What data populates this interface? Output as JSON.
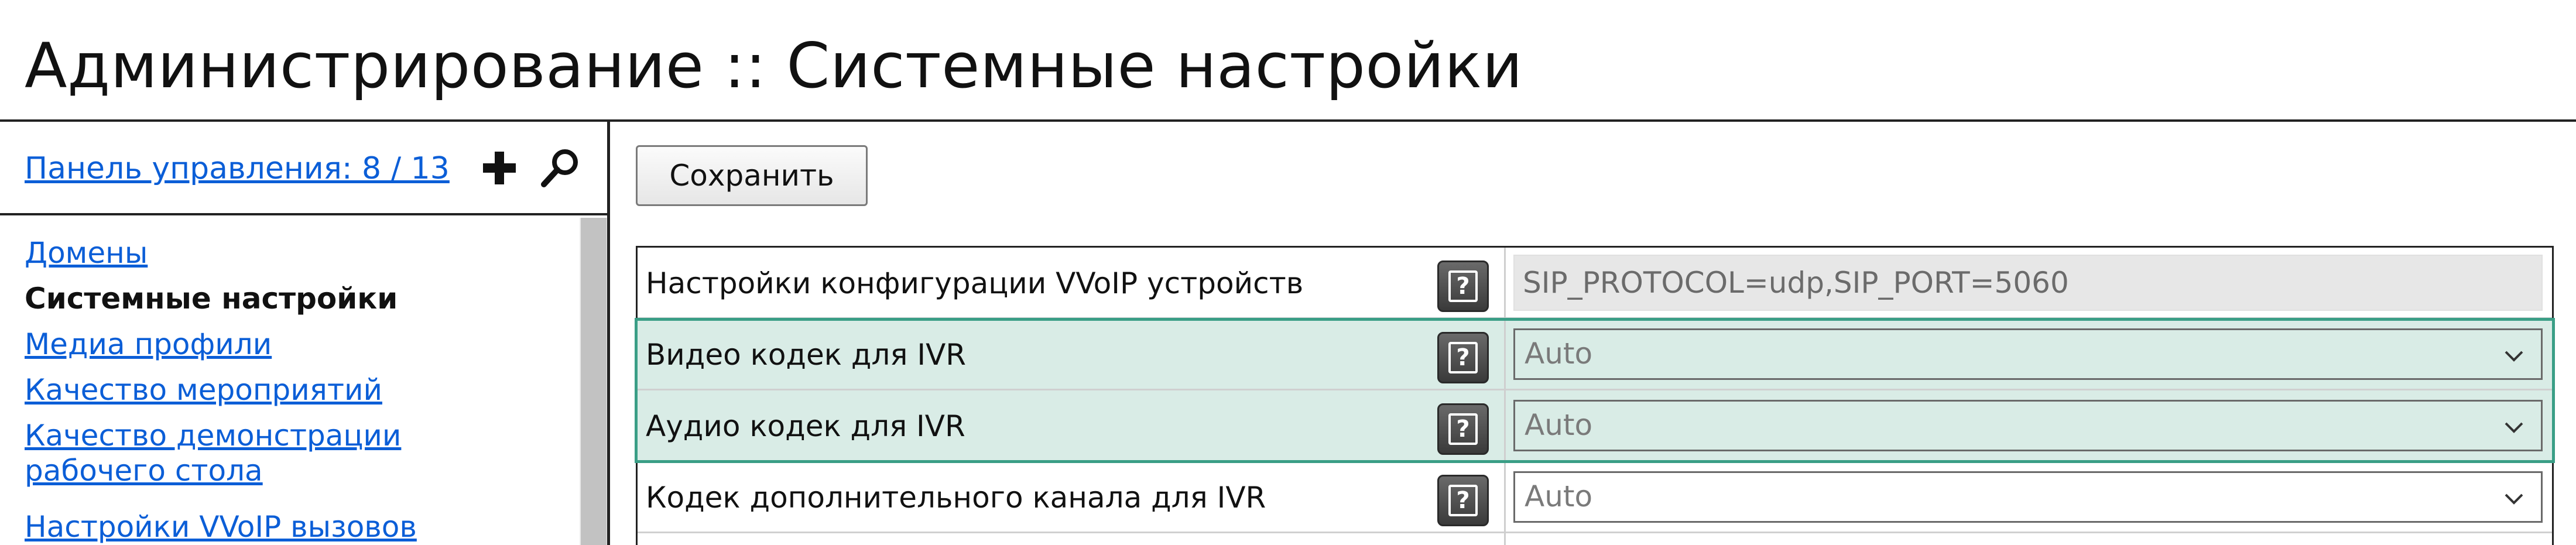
{
  "page": {
    "title": "Администрирование :: Системные настройки"
  },
  "sidebar": {
    "panel_link": "Панель управления: 8 / 13",
    "icons": {
      "add": "plus-icon",
      "search": "search-icon"
    },
    "items": [
      {
        "label": "Домены",
        "active": false
      },
      {
        "label": "Системные настройки",
        "active": true
      },
      {
        "label": "Медиа профили",
        "active": false
      },
      {
        "label": "Качество мероприятий",
        "active": false
      },
      {
        "label": "Качество демонстрации рабочего стола",
        "active": false
      },
      {
        "label": "Настройки VVoIP вызовов",
        "active": false
      }
    ]
  },
  "toolbar": {
    "save_label": "Сохранить"
  },
  "settings": {
    "rows": [
      {
        "label": "Настройки конфигурации VVoIP устройств",
        "help": "?",
        "value": "SIP_PROTOCOL=udp,SIP_PORT=5060",
        "kind": "text"
      },
      {
        "label": "Видео кодек для IVR",
        "help": "?",
        "value": "Auto",
        "kind": "select"
      },
      {
        "label": "Аудио кодек для IVR",
        "help": "?",
        "value": "Auto",
        "kind": "select"
      },
      {
        "label": "Кодек дополнительного канала для IVR",
        "help": "?",
        "value": "Auto",
        "kind": "select"
      }
    ]
  },
  "colors": {
    "link": "#0b5ed7",
    "highlight_bg": "#d9ece6",
    "highlight_border": "#3a9e86"
  }
}
